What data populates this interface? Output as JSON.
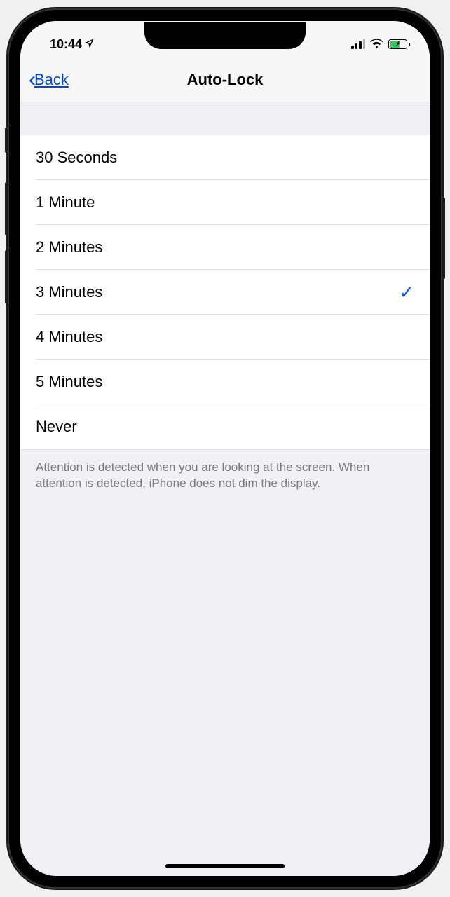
{
  "status_bar": {
    "time": "10:44"
  },
  "nav": {
    "back_label": "Back",
    "title": "Auto-Lock"
  },
  "options": [
    {
      "label": "30 Seconds",
      "selected": false
    },
    {
      "label": "1 Minute",
      "selected": false
    },
    {
      "label": "2 Minutes",
      "selected": false
    },
    {
      "label": "3 Minutes",
      "selected": true
    },
    {
      "label": "4 Minutes",
      "selected": false
    },
    {
      "label": "5 Minutes",
      "selected": false
    },
    {
      "label": "Never",
      "selected": false
    }
  ],
  "footer_text": "Attention is detected when you are looking at the screen. When attention is detected, iPhone does not dim the display."
}
